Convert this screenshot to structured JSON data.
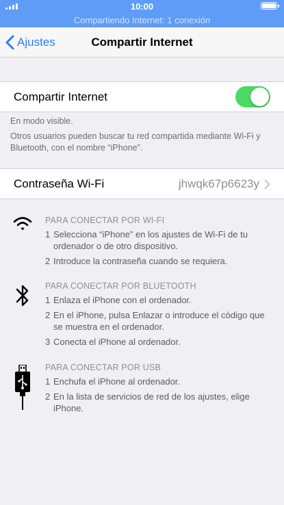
{
  "status_bar": {
    "time": "10:00",
    "hotspot_status": "Compartiendo Internet: 1 conexión",
    "accent_color": "#5e9cf7"
  },
  "nav": {
    "back_label": "Ajustes",
    "title": "Compartir Internet"
  },
  "hotspot_toggle": {
    "label": "Compartir Internet",
    "on": true,
    "on_color": "#4cd964"
  },
  "visibility_note": "En modo visible.",
  "discover_note": "Otros usuarios pueden buscar tu red compartida mediante Wi-Fi y Bluetooth, con el nombre “iPhone”.",
  "wifi_password": {
    "label": "Contraseña Wi-Fi",
    "value": "jhwqk67p6623y"
  },
  "instructions": {
    "wifi": {
      "icon": "wifi-icon",
      "heading": "PARA CONECTAR POR WI-FI",
      "steps": [
        {
          "num": "1",
          "text": "Selecciona “iPhone” en los ajustes de Wi-Fi de tu ordenador o de otro dispositivo."
        },
        {
          "num": "2",
          "text": "Introduce la contraseña cuando se requiera."
        }
      ]
    },
    "bluetooth": {
      "icon": "bluetooth-icon",
      "heading": "PARA CONECTAR POR BLUETOOTH",
      "steps": [
        {
          "num": "1",
          "text": "Enlaza el iPhone con el ordenador."
        },
        {
          "num": "2",
          "text": "En el iPhone, pulsa Enlazar o introduce el código que se muestra en el ordenador."
        },
        {
          "num": "3",
          "text": "Conecta el iPhone al ordenador."
        }
      ]
    },
    "usb": {
      "icon": "usb-cable-icon",
      "heading": "PARA CONECTAR POR USB",
      "steps": [
        {
          "num": "1",
          "text": "Enchufa el iPhone al ordenador."
        },
        {
          "num": "2",
          "text": "En la lista de servicios de red de los ajustes, elige iPhone."
        }
      ]
    }
  }
}
